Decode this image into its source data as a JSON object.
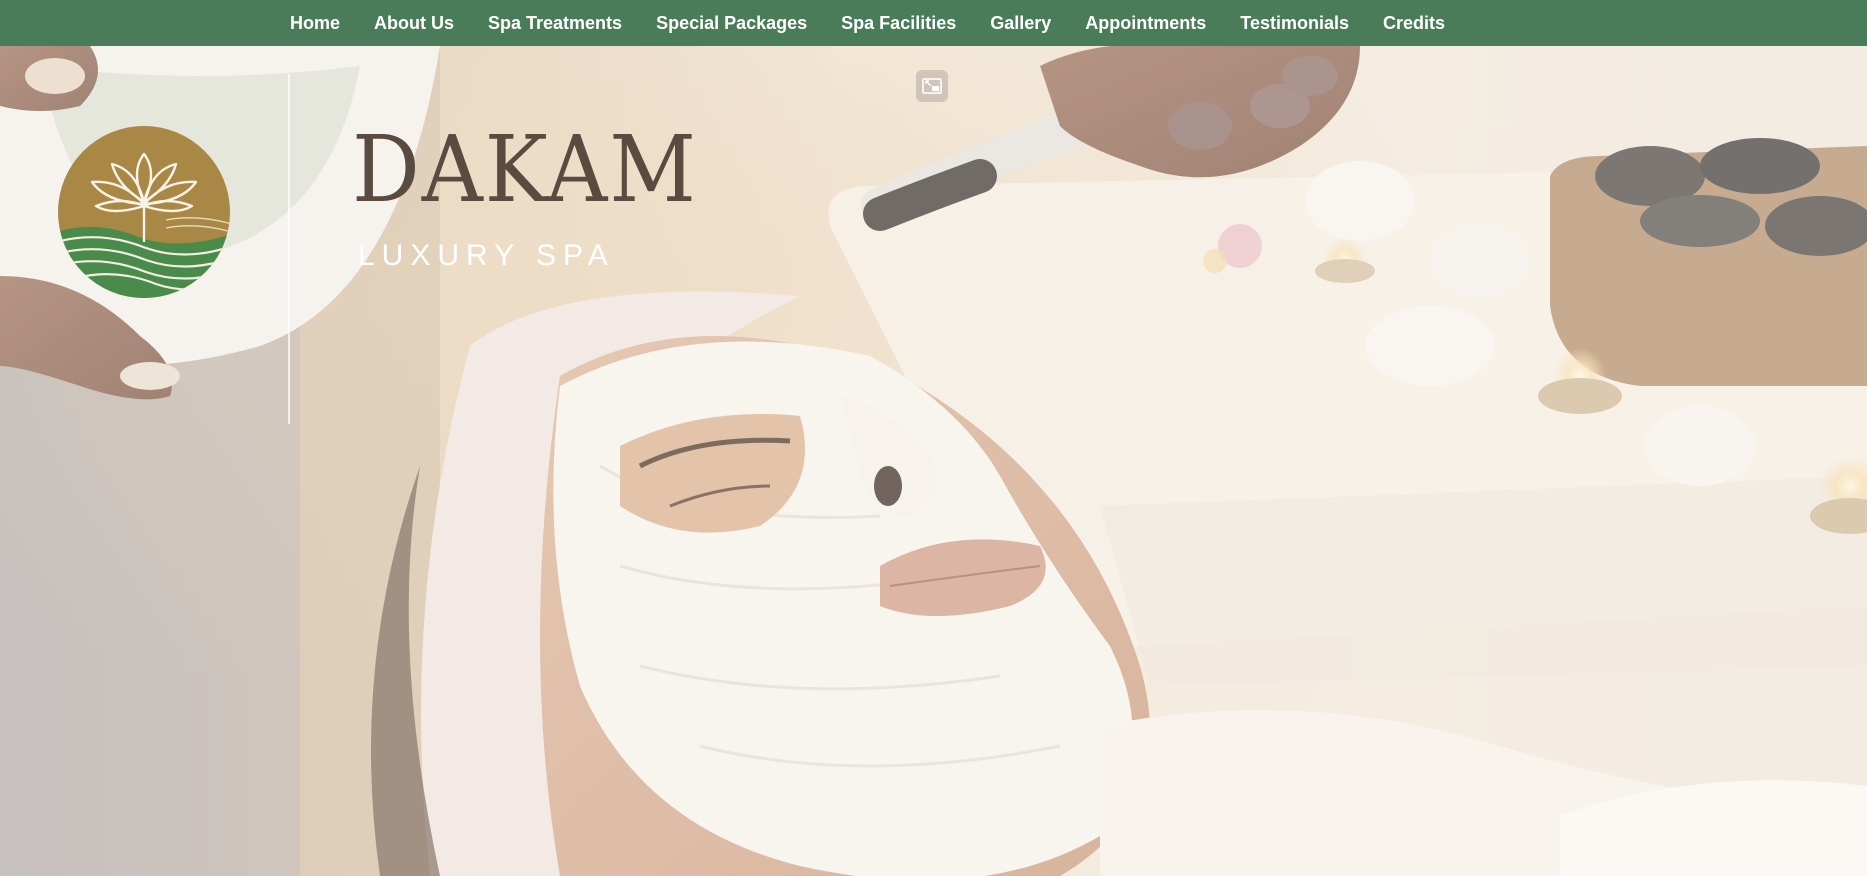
{
  "nav": {
    "items": [
      {
        "label": "Home"
      },
      {
        "label": "About Us"
      },
      {
        "label": "Spa Treatments"
      },
      {
        "label": "Special Packages"
      },
      {
        "label": "Spa Facilities"
      },
      {
        "label": "Gallery"
      },
      {
        "label": "Appointments"
      },
      {
        "label": "Testimonials"
      },
      {
        "label": "Credits"
      }
    ]
  },
  "brand": {
    "name": "DAKAM",
    "tagline": "LUXURY SPA",
    "logo_icon": "lotus-icon"
  },
  "hero": {
    "icon": "exit-fullscreen-icon"
  },
  "colors": {
    "nav_bg": "#4a7c59",
    "nav_text": "#ffffff",
    "logo_gold": "#a98745",
    "logo_green": "#4a8a4b",
    "brand_text": "#5b4a40"
  }
}
